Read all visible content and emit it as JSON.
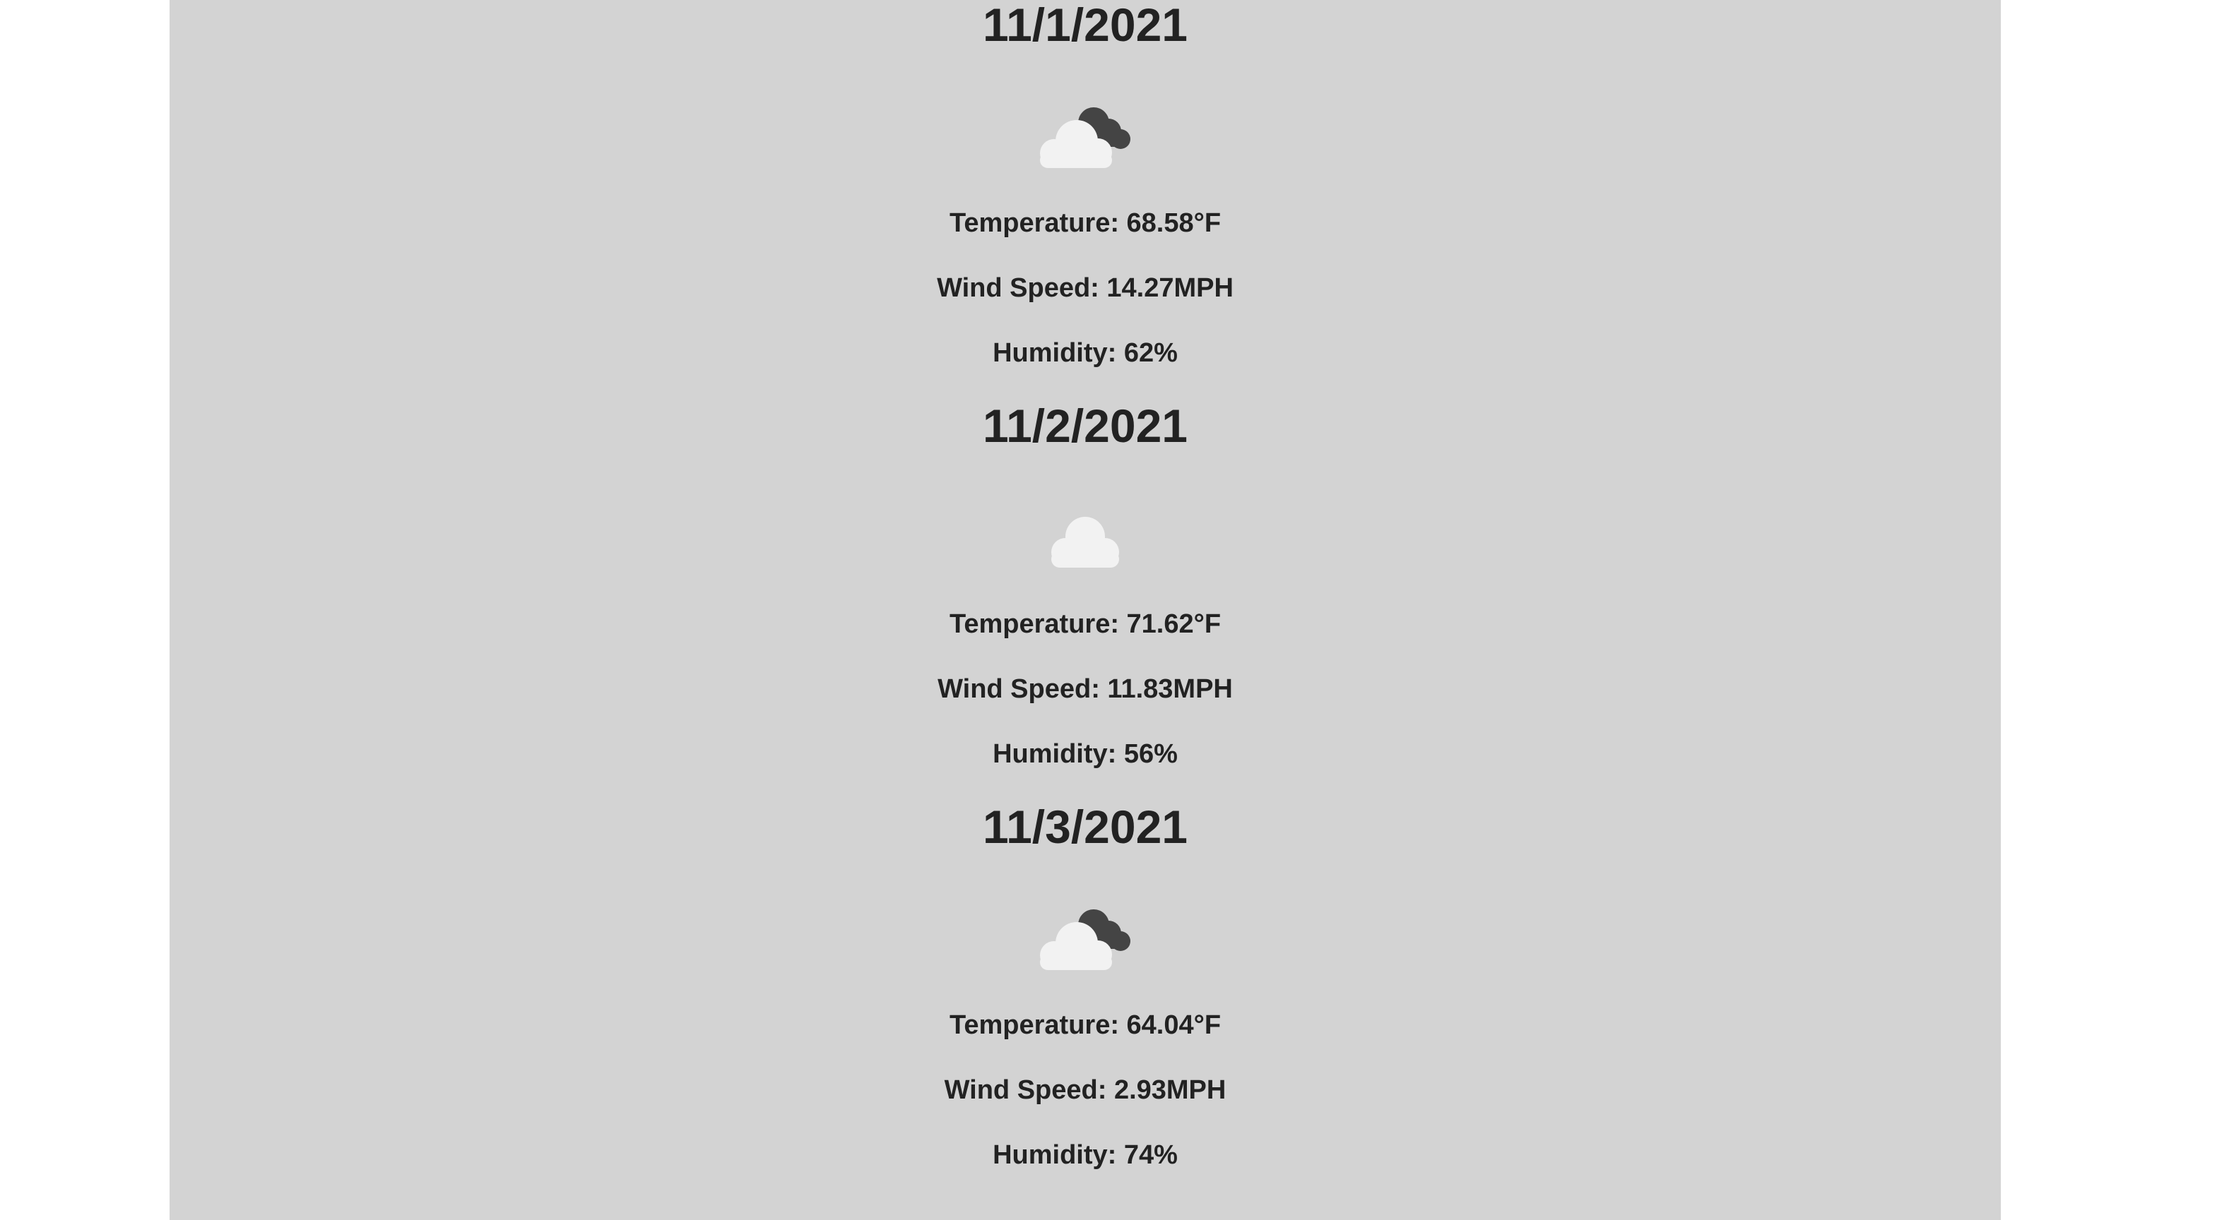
{
  "forecast": {
    "days": [
      {
        "date": "11/1/2021",
        "icon": "partly-cloudy-icon",
        "temperature": "Temperature: 68.58°F",
        "wind_speed": "Wind Speed: 14.27MPH",
        "humidity": "Humidity: 62%"
      },
      {
        "date": "11/2/2021",
        "icon": "cloud-icon",
        "temperature": "Temperature: 71.62°F",
        "wind_speed": "Wind Speed: 11.83MPH",
        "humidity": "Humidity: 56%"
      },
      {
        "date": "11/3/2021",
        "icon": "partly-cloudy-icon",
        "temperature": "Temperature: 64.04°F",
        "wind_speed": "Wind Speed: 2.93MPH",
        "humidity": "Humidity: 74%"
      }
    ]
  },
  "colors": {
    "panel_background": "#d3d3d3",
    "page_background": "#ffffff",
    "text": "#222222",
    "cloud_light": "#f2f2f2",
    "cloud_dark": "#444444"
  }
}
